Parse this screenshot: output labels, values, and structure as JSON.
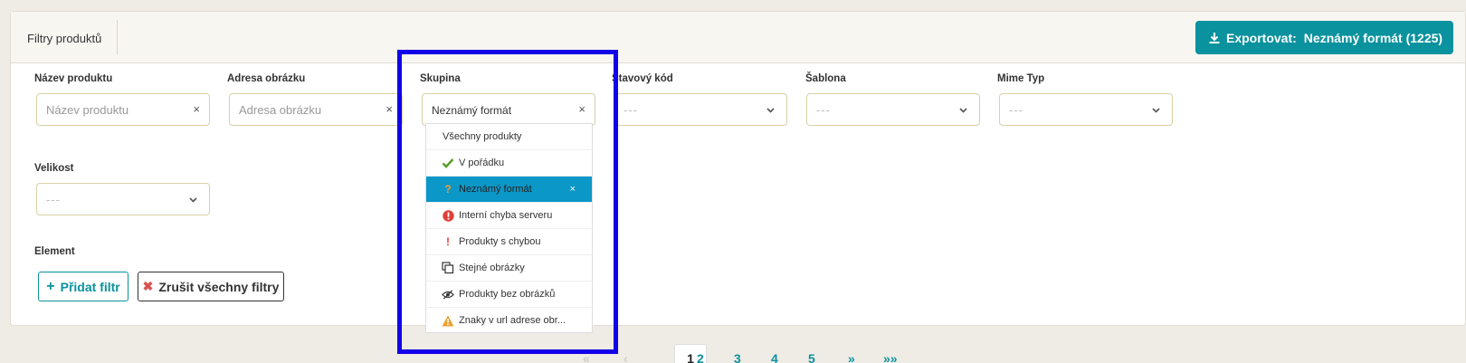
{
  "header": {
    "title": "Filtry produktů",
    "export_label": "Exportovat:",
    "export_value": "Neznámý formát (1225)"
  },
  "filters": {
    "product_name": {
      "label": "Název produktu",
      "placeholder": "Název produktu",
      "clear": "×"
    },
    "image_url": {
      "label": "Adresa obrázku",
      "placeholder": "Adresa obrázku",
      "clear": "×"
    },
    "group": {
      "label": "Skupina",
      "value": "Neznámý formát",
      "clear": "×"
    },
    "status_code": {
      "label": "Stavový kód",
      "value": "---"
    },
    "template": {
      "label": "Šablona",
      "value": "---"
    },
    "mime_type": {
      "label": "Mime Typ",
      "value": "---"
    },
    "size": {
      "label": "Velikost",
      "value": "---"
    },
    "element": {
      "label": "Element"
    }
  },
  "buttons": {
    "add_filter": "Přidat filtr",
    "clear_all": "Zrušit všechny filtry"
  },
  "dropdown": {
    "items": [
      {
        "label": "Všechny produkty",
        "icon": ""
      },
      {
        "label": "V pořádku",
        "icon": "check-icon"
      },
      {
        "label": "Neznámý formát",
        "icon": "question-icon",
        "selected": true
      },
      {
        "label": "Interní chyba serveru",
        "icon": "error-circle-icon"
      },
      {
        "label": "Produkty s chybou",
        "icon": "exclamation-icon"
      },
      {
        "label": "Stejné obrázky",
        "icon": "copy-icon"
      },
      {
        "label": "Produkty bez obrázků",
        "icon": "eye-slash-icon"
      },
      {
        "label": "Znaky v url adrese obr...",
        "icon": "warning-icon"
      }
    ],
    "selected_clear": "×"
  },
  "pagination": {
    "first": "«",
    "prev": "‹",
    "pages": [
      "1",
      "2",
      "3",
      "4",
      "5"
    ],
    "next": "»",
    "last": "»»",
    "active": "1"
  },
  "colors": {
    "accent": "#0a929e",
    "selected_item": "#0b97c8",
    "highlight_box": "#1200e8",
    "input_border": "#d8d1a6"
  }
}
